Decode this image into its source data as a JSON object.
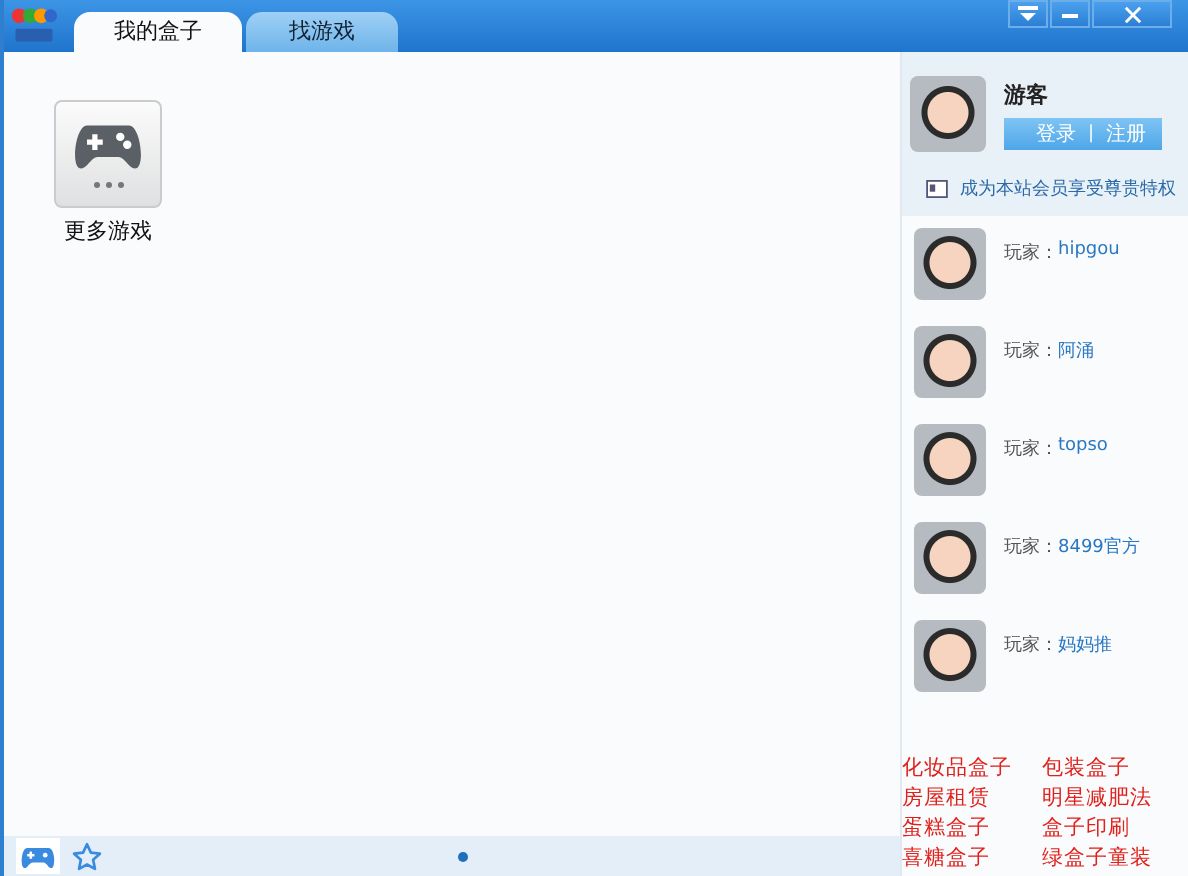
{
  "tabs": [
    {
      "label": "我的盒子",
      "selected": true
    },
    {
      "label": "找游戏",
      "selected": false
    }
  ],
  "games": [
    {
      "label": "更多游戏"
    }
  ],
  "user": {
    "name": "游客",
    "login": "登录",
    "separator": "|",
    "register": "注册",
    "promo": "成为本站会员享受尊贵特权"
  },
  "players": [
    {
      "prefix": "玩家：",
      "name": "hipgou"
    },
    {
      "prefix": "玩家：",
      "name": "阿涌"
    },
    {
      "prefix": "玩家：",
      "name": "topso"
    },
    {
      "prefix": "玩家：",
      "name": "8499官方"
    },
    {
      "prefix": "玩家：",
      "name": "妈妈推"
    }
  ],
  "ad_links": [
    "化妆品盒子",
    "包装盒子",
    "房屋租赁",
    "明星减肥法",
    "蛋糕盒子",
    "盒子印刷",
    "喜糖盒子",
    "绿盒子童装"
  ],
  "pager": [
    {
      "selected": true
    }
  ]
}
